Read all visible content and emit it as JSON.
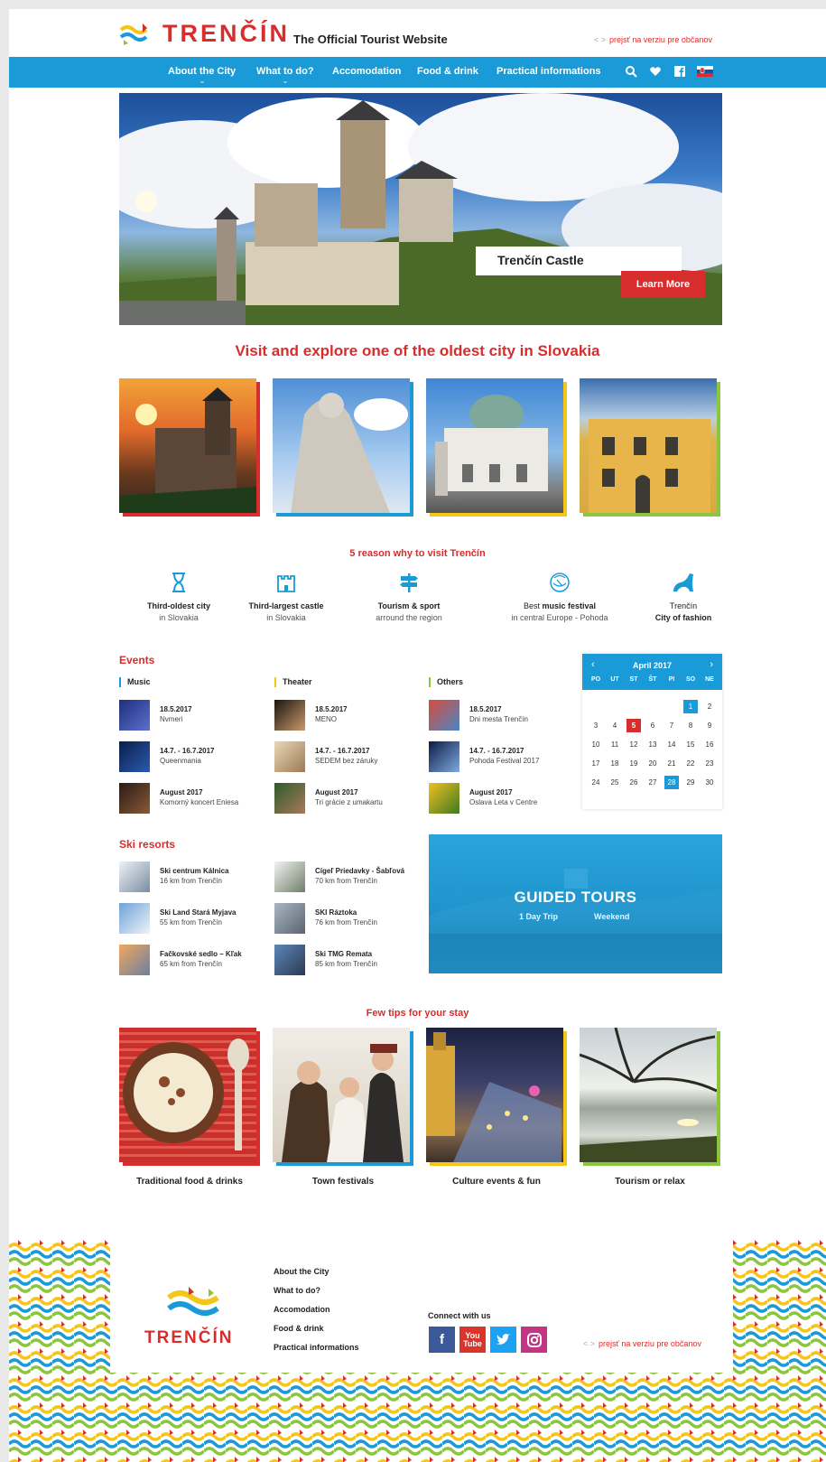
{
  "header": {
    "logo_text": "TRENČÍN",
    "tagline": "The Official Tourist Website",
    "citizen_link": "prejsť na verziu pre občanov",
    "citizen_arrows": "< >"
  },
  "nav": {
    "items": [
      {
        "label": "About the City"
      },
      {
        "label": "What to do?"
      },
      {
        "label": "Accomodation"
      },
      {
        "label": "Food & drink"
      },
      {
        "label": "Practical informations"
      }
    ]
  },
  "hero": {
    "caption": "Trenčín Castle",
    "button": "Learn More"
  },
  "intro": {
    "heading": "Visit and explore one of the oldest city in Slovakia"
  },
  "reasons": {
    "heading": "5 reason why to visit Trenčín",
    "items": [
      {
        "line1": "Third-oldest city",
        "line2": "in Slovakia",
        "icon": "hourglass-icon"
      },
      {
        "line1": "Third-largest castle",
        "line2": "in Slovakia",
        "icon": "castle-icon"
      },
      {
        "line1": "Tourism & sport",
        "line2": "arround the region",
        "icon": "signpost-icon"
      },
      {
        "line1a": "Best ",
        "line1b": "music festival",
        "line2": "in central Europe - Pohoda",
        "icon": "festival-icon"
      },
      {
        "line1": "Trenčín",
        "line2": "City of fashion",
        "icon": "high-heel-icon"
      }
    ]
  },
  "events": {
    "heading": "Events",
    "columns": [
      {
        "title": "Music",
        "items": [
          {
            "date": "18.5.2017",
            "name": "Nvmeri"
          },
          {
            "date": "14.7. - 16.7.2017",
            "name": "Queenmania"
          },
          {
            "date": "August 2017",
            "name": "Komorný koncert Eniesa"
          }
        ]
      },
      {
        "title": "Theater",
        "items": [
          {
            "date": "18.5.2017",
            "name": "MENO"
          },
          {
            "date": "14.7. - 16.7.2017",
            "name": "SEDEM bez záruky"
          },
          {
            "date": "August 2017",
            "name": "Tri grácie z umakartu"
          }
        ]
      },
      {
        "title": "Others",
        "items": [
          {
            "date": "18.5.2017",
            "name": "Dni mesta Trenčín"
          },
          {
            "date": "14.7. - 16.7.2017",
            "name": "Pohoda Festival 2017"
          },
          {
            "date": "August 2017",
            "name": "Oslava Leta v Centre"
          }
        ]
      }
    ]
  },
  "calendar": {
    "month": "April 2017",
    "prev": "‹",
    "next": "›",
    "dow": [
      "PO",
      "UT",
      "ST",
      "ŠT",
      "PI",
      "SO",
      "NE"
    ],
    "weeks": [
      [
        "",
        "",
        "",
        "",
        "",
        "1",
        "2"
      ],
      [
        "3",
        "4",
        "5",
        "6",
        "7",
        "8",
        "9"
      ],
      [
        "10",
        "11",
        "12",
        "13",
        "14",
        "15",
        "16"
      ],
      [
        "17",
        "18",
        "19",
        "20",
        "21",
        "22",
        "23"
      ],
      [
        "24",
        "25",
        "26",
        "27",
        "28",
        "29",
        "30"
      ]
    ],
    "highlight_blue": [
      "1",
      "28"
    ],
    "highlight_red": [
      "5"
    ]
  },
  "ski": {
    "heading": "Ski resorts",
    "items": [
      {
        "name": "Ski centrum Kálnica",
        "dist": "16 km from Trenčín"
      },
      {
        "name": "Cígeľ Priedavky - Šabľová",
        "dist": "70 km from Trenčín"
      },
      {
        "name": "Ski Land Stará Myjava",
        "dist": "55 km from Trenčín"
      },
      {
        "name": "SKI Ráztoka",
        "dist": "76 km from Trenčín"
      },
      {
        "name": "Fačkovské sedlo – Kľak",
        "dist": "65 km from Trenčín"
      },
      {
        "name": "Ski TMG Remata",
        "dist": "85 km from Trenčín"
      }
    ]
  },
  "tours": {
    "title": "GUIDED TOURS",
    "option1": "1 Day Trip",
    "option2": "Weekend"
  },
  "tips": {
    "heading": "Few tips for your stay",
    "items": [
      {
        "label": "Traditional food & drinks"
      },
      {
        "label": "Town festivals"
      },
      {
        "label": "Culture events & fun"
      },
      {
        "label": "Tourism or relax"
      }
    ]
  },
  "footer": {
    "logo_text": "TRENČÍN",
    "links": [
      "About the City",
      "What to do?",
      "Accomodation",
      "Food & drink",
      "Practical informations"
    ],
    "connect": "Connect with us",
    "citizen_link": "prejsť na verziu pre občanov",
    "citizen_arrows": "< >"
  },
  "colors": {
    "brand_red": "#d72d2d",
    "brand_blue": "#1a9bd7",
    "accent_yellow": "#f5c518",
    "accent_green": "#8cc63f"
  }
}
